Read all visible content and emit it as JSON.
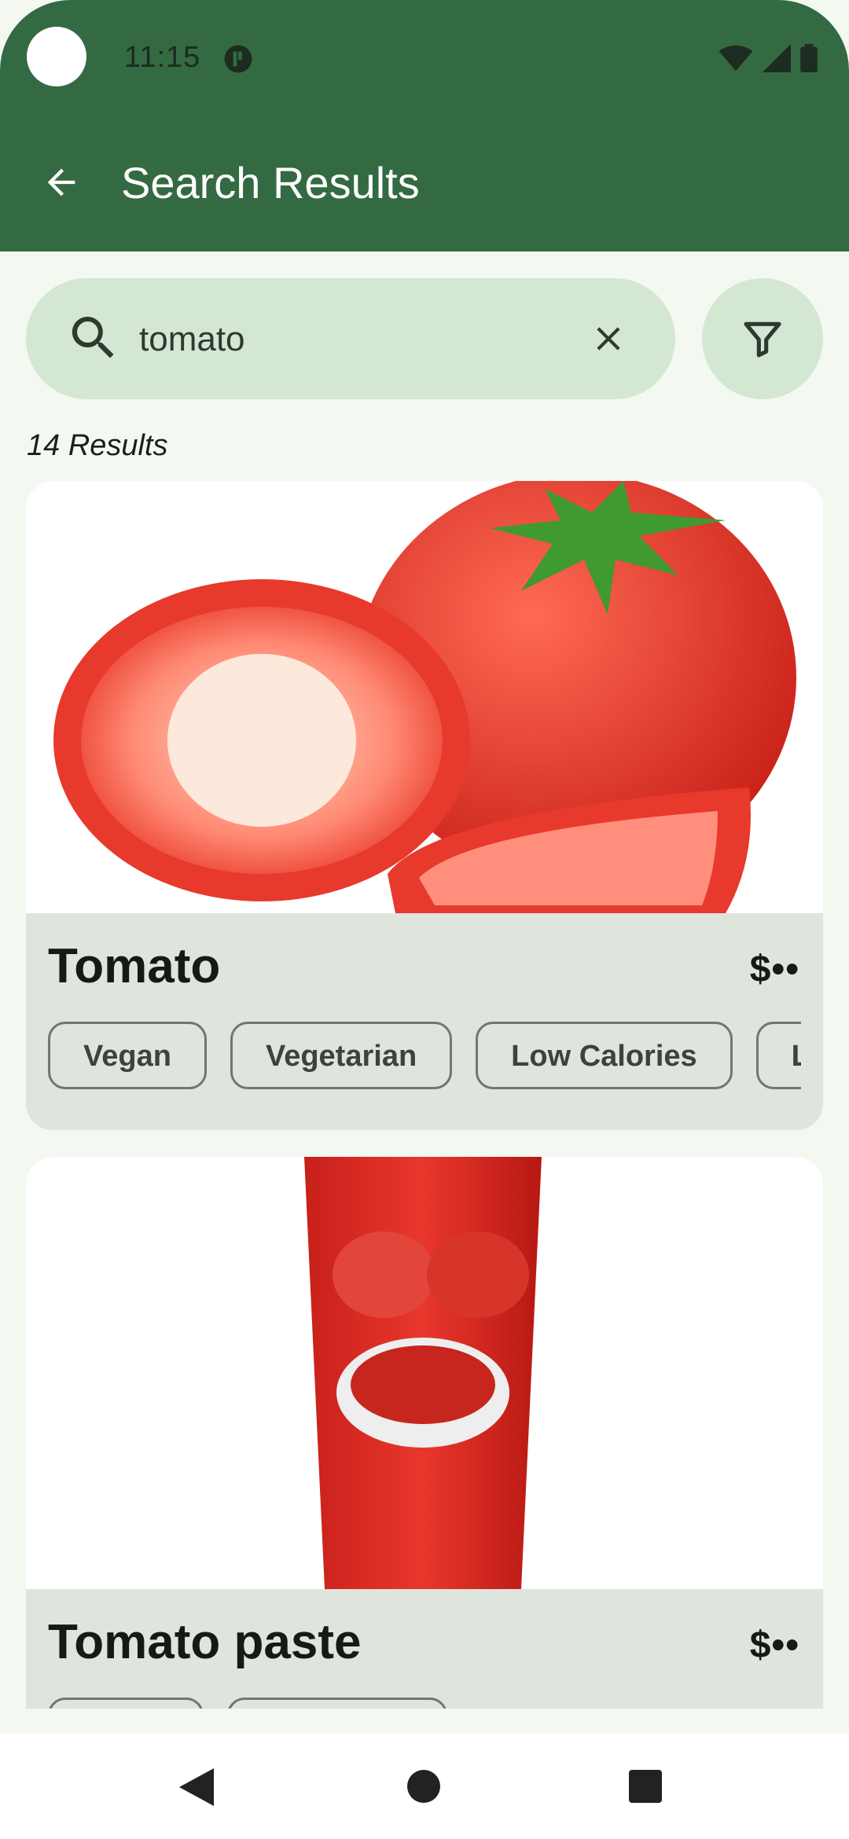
{
  "status_bar": {
    "time": "11:15"
  },
  "header": {
    "title": "Search Results"
  },
  "search": {
    "value": "tomato",
    "placeholder": ""
  },
  "results": {
    "count_label": "14 Results"
  },
  "cards": [
    {
      "title": "Tomato",
      "price": "$••",
      "tags": [
        "Vegan",
        "Vegetarian",
        "Low Calories",
        "L"
      ]
    },
    {
      "title": "Tomato paste",
      "price": "$••",
      "tags": [
        "",
        ""
      ]
    }
  ],
  "colors": {
    "app_bar": "#336a42",
    "background": "#f3f8f1",
    "search_fill": "#d3e7d3",
    "card_fill": "#dfe4dc"
  },
  "icons": {
    "back": "arrow-left-icon",
    "search": "search-icon",
    "clear": "close-icon",
    "filter": "filter-icon"
  }
}
